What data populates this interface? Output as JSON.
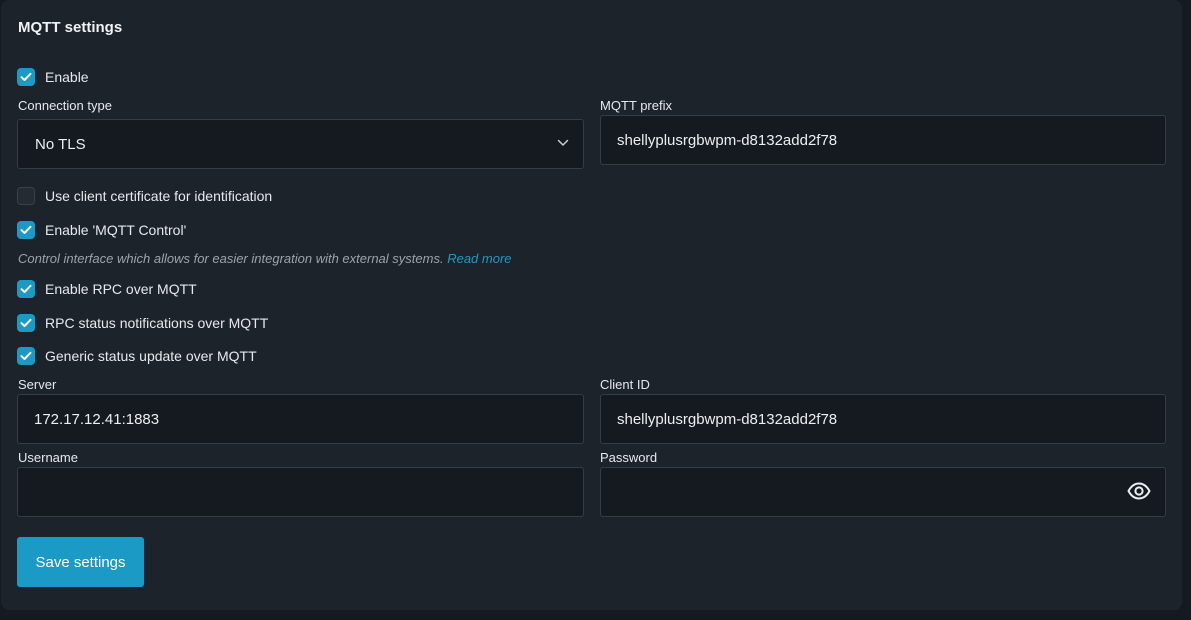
{
  "section": {
    "title": "MQTT settings"
  },
  "enable": {
    "label": "Enable",
    "checked": true
  },
  "connection_type": {
    "label": "Connection type",
    "value": "No TLS"
  },
  "mqtt_prefix": {
    "label": "MQTT prefix",
    "value": "shellyplusrgbwpm-d8132add2f78"
  },
  "client_cert": {
    "label": "Use client certificate for identification",
    "checked": false
  },
  "mqtt_control": {
    "label": "Enable 'MQTT Control'",
    "checked": true
  },
  "hint": {
    "text": "Control interface which allows for easier integration with external systems.",
    "link": "Read more"
  },
  "rpc": {
    "label": "Enable RPC over MQTT",
    "checked": true
  },
  "rpc_status": {
    "label": "RPC status notifications over MQTT",
    "checked": true
  },
  "generic_status": {
    "label": "Generic status update over MQTT",
    "checked": true
  },
  "server": {
    "label": "Server",
    "value": "172.17.12.41:1883"
  },
  "client_id": {
    "label": "Client ID",
    "value": "shellyplusrgbwpm-d8132add2f78"
  },
  "username": {
    "label": "Username",
    "value": ""
  },
  "password": {
    "label": "Password",
    "value": ""
  },
  "save": {
    "label": "Save settings"
  },
  "colors": {
    "accent": "#1b9ac6",
    "card_bg": "#1d232a",
    "page_bg": "#151a20",
    "input_bg": "#141a20"
  },
  "icons": {
    "checkbox": "check-icon",
    "select": "chevron-down-icon",
    "password_toggle": "eye-icon"
  }
}
